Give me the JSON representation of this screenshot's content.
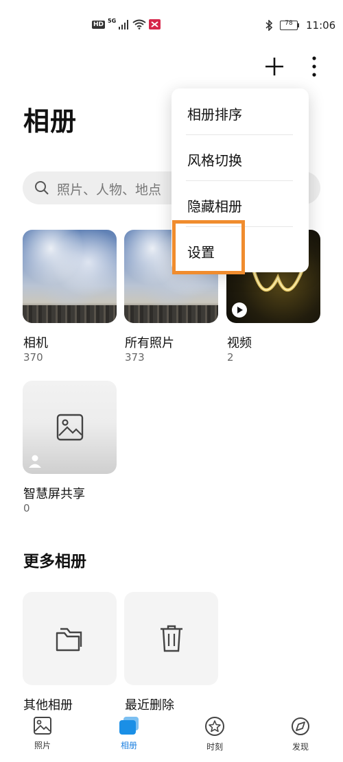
{
  "status_bar": {
    "time": "11:06",
    "battery": "78",
    "network": "5G",
    "hd": "HD"
  },
  "header": {
    "title": "相册"
  },
  "search": {
    "placeholder": "照片、人物、地点"
  },
  "albums": [
    {
      "name": "相机",
      "count": "370"
    },
    {
      "name": "所有照片",
      "count": "373"
    },
    {
      "name": "视频",
      "count": "2"
    },
    {
      "name": "智慧屏共享",
      "count": "0"
    }
  ],
  "more_albums": {
    "title": "更多相册",
    "items": [
      {
        "name": "其他相册"
      },
      {
        "name": "最近删除"
      }
    ]
  },
  "menu": {
    "items": [
      "相册排序",
      "风格切换",
      "隐藏相册",
      "设置"
    ]
  },
  "bottom_nav": {
    "items": [
      "照片",
      "相册",
      "时刻",
      "发现"
    ],
    "active": "相册"
  },
  "colors": {
    "accent": "#1a7fe0",
    "highlight": "#f08c2e"
  }
}
